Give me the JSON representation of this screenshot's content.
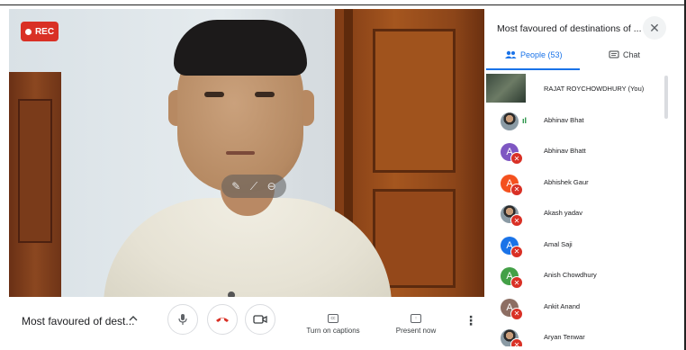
{
  "recording": {
    "label": "REC",
    "color": "#d93025"
  },
  "meeting": {
    "title_short": "Most favoured of dest...",
    "chevron": "^"
  },
  "controls": {
    "mic_icon": "microphone-icon",
    "hangup_icon": "phone-hangup-icon",
    "camera_icon": "camera-icon",
    "captions_label": "Turn on captions",
    "captions_icon_text": "cc",
    "present_label": "Present now",
    "present_icon_text": "↑",
    "more": "⋮"
  },
  "tile_overlay": {
    "pin": "✎",
    "mute": "⟋",
    "remove": "⊖"
  },
  "panel": {
    "title": "Most favoured of destinations of ...",
    "close": "✕",
    "tabs": {
      "people": "People (53)",
      "chat": "Chat"
    },
    "accent": "#1a73e8",
    "participants": [
      {
        "name": "RAJAT ROYCHOWDHURY (You)",
        "avatar": "video-thumbnail",
        "muted": false
      },
      {
        "name": "Abhinav Bhat",
        "avatar": "photo",
        "muted": false,
        "speaking": true
      },
      {
        "name": "Abhinav Bhatt",
        "avatar": "A",
        "color": "#7e57c2",
        "muted": true
      },
      {
        "name": "Abhishek Gaur",
        "avatar": "A",
        "color": "#f4511e",
        "muted": true
      },
      {
        "name": "Akash yadav",
        "avatar": "photo",
        "muted": true
      },
      {
        "name": "Amal Saji",
        "avatar": "A",
        "color": "#1a73e8",
        "muted": true
      },
      {
        "name": "Anish Chowdhury",
        "avatar": "A",
        "color": "#43a047",
        "muted": true
      },
      {
        "name": "Ankit Anand",
        "avatar": "A",
        "color": "#8d6e63",
        "muted": true
      },
      {
        "name": "Aryan Tenwar",
        "avatar": "photo",
        "muted": true
      }
    ]
  }
}
